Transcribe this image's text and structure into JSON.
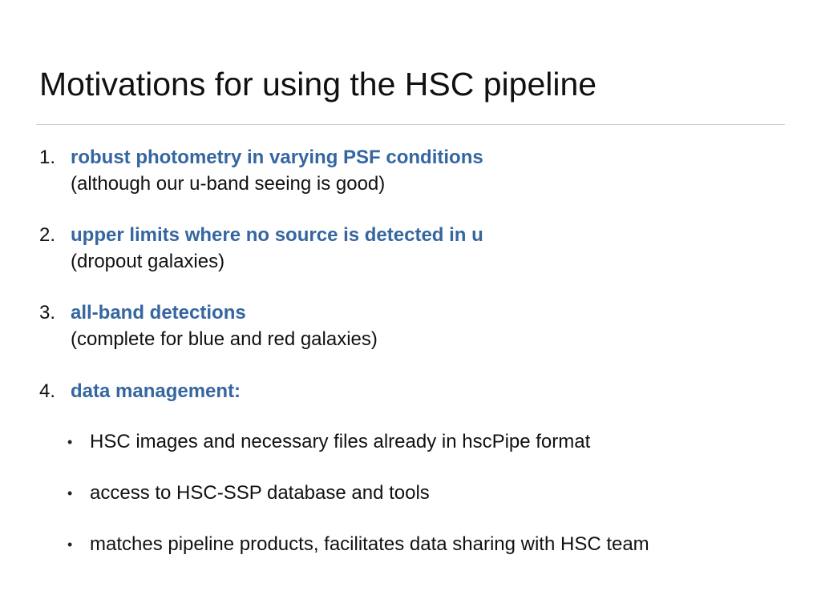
{
  "slide": {
    "title": "Motivations for using the HSC pipeline",
    "items": [
      {
        "number": "1.",
        "heading": "robust photometry in varying PSF conditions",
        "sub": "(although our u-band seeing is good)"
      },
      {
        "number": "2.",
        "heading": "upper limits where no source is detected in u",
        "sub": "(dropout galaxies)"
      },
      {
        "number": "3.",
        "heading": "all-band detections",
        "sub": "(complete for blue and red galaxies)"
      },
      {
        "number": "4.",
        "heading": "data management:",
        "sub": ""
      }
    ],
    "bullets": [
      "HSC images and necessary files already in hscPipe format",
      "access to HSC-SSP database and tools",
      "matches pipeline products, facilitates data sharing with HSC team"
    ],
    "bullet_glyph": "•",
    "colors": {
      "heading": "#3566a0",
      "text": "#111111",
      "rule": "#d0d0d0",
      "background": "#ffffff"
    }
  }
}
